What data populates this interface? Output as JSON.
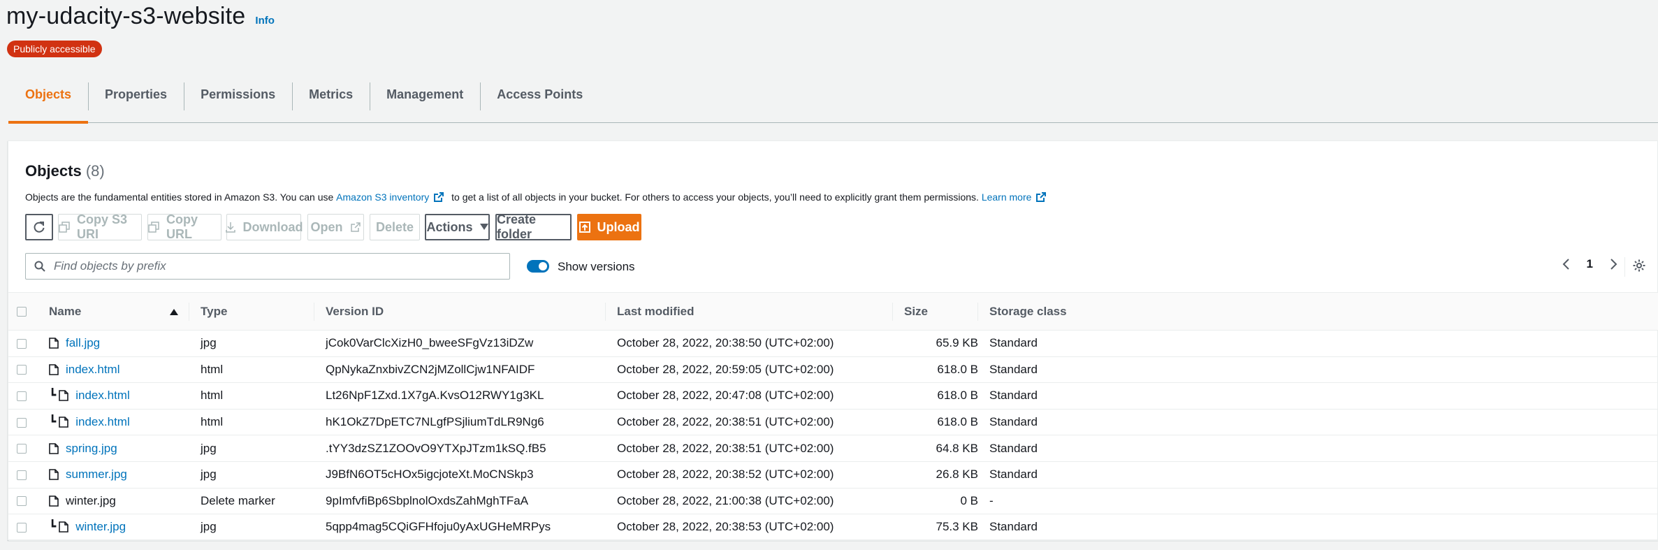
{
  "page": {
    "title": "my-udacity-s3-website",
    "info_label": "Info",
    "badge": "Publicly accessible"
  },
  "tabs": [
    {
      "label": "Objects",
      "active": true
    },
    {
      "label": "Properties",
      "active": false
    },
    {
      "label": "Permissions",
      "active": false
    },
    {
      "label": "Metrics",
      "active": false
    },
    {
      "label": "Management",
      "active": false
    },
    {
      "label": "Access Points",
      "active": false
    }
  ],
  "objects_panel": {
    "title": "Objects",
    "count": "(8)",
    "desc_part1": "Objects are the fundamental entities stored in Amazon S3. You can use ",
    "desc_link1": "Amazon S3 inventory",
    "desc_part2": " to get a list of all objects in your bucket. For others to access your objects, you’ll need to explicitly grant them permissions. ",
    "desc_link2": "Learn more"
  },
  "toolbar": {
    "copy_s3_uri": "Copy S3 URI",
    "copy_url": "Copy URL",
    "download": "Download",
    "open": "Open",
    "delete": "Delete",
    "actions": "Actions",
    "create_folder": "Create folder",
    "upload": "Upload"
  },
  "search": {
    "placeholder": "Find objects by prefix"
  },
  "show_versions": {
    "label": "Show versions",
    "enabled": true
  },
  "pagination": {
    "page": "1"
  },
  "colors": {
    "accent": "#ec7211",
    "link": "#0073bb",
    "badge": "#d13212"
  },
  "table": {
    "columns": {
      "name": "Name",
      "type": "Type",
      "version_id": "Version ID",
      "last_modified": "Last modified",
      "size": "Size",
      "storage_class": "Storage class"
    },
    "rows": [
      {
        "name": "fall.jpg",
        "type": "jpg",
        "version_id": "jCok0VarClcXizH0_bweeSFgVz13iDZw",
        "last_modified": "October 28, 2022, 20:38:50 (UTC+02:00)",
        "size": "65.9 KB",
        "storage_class": "Standard"
      },
      {
        "name": "index.html",
        "type": "html",
        "version_id": "QpNykaZnxbivZCN2jMZollCjw1NFAIDF",
        "last_modified": "October 28, 2022, 20:59:05 (UTC+02:00)",
        "size": "618.0 B",
        "storage_class": "Standard"
      },
      {
        "name": "index.html",
        "type": "html",
        "version_id": "Lt26NpF1Zxd.1X7gA.KvsO12RWY1g3KL",
        "last_modified": "October 28, 2022, 20:47:08 (UTC+02:00)",
        "size": "618.0 B",
        "storage_class": "Standard"
      },
      {
        "name": "index.html",
        "type": "html",
        "version_id": "hK1OkZ7DpETC7NLgfPSjliumTdLR9Ng6",
        "last_modified": "October 28, 2022, 20:38:51 (UTC+02:00)",
        "size": "618.0 B",
        "storage_class": "Standard"
      },
      {
        "name": "spring.jpg",
        "type": "jpg",
        "version_id": ".tYY3dzSZ1ZOOvO9YTXpJTzm1kSQ.fB5",
        "last_modified": "October 28, 2022, 20:38:51 (UTC+02:00)",
        "size": "64.8 KB",
        "storage_class": "Standard"
      },
      {
        "name": "summer.jpg",
        "type": "jpg",
        "version_id": "J9BfN6OT5cHOx5igcjoteXt.MoCNSkp3",
        "last_modified": "October 28, 2022, 20:38:52 (UTC+02:00)",
        "size": "26.8 KB",
        "storage_class": "Standard"
      },
      {
        "name": "winter.jpg",
        "type": "Delete marker",
        "version_id": "9pImfvfiBp6SbplnolOxdsZahMghTFaA",
        "last_modified": "October 28, 2022, 21:00:38 (UTC+02:00)",
        "size": "0 B",
        "storage_class": "-"
      },
      {
        "name": "winter.jpg",
        "type": "jpg",
        "version_id": "5qpp4mag5CQiGFHfoju0yAxUGHeMRPys",
        "last_modified": "October 28, 2022, 20:38:53 (UTC+02:00)",
        "size": "75.3 KB",
        "storage_class": "Standard"
      }
    ]
  }
}
